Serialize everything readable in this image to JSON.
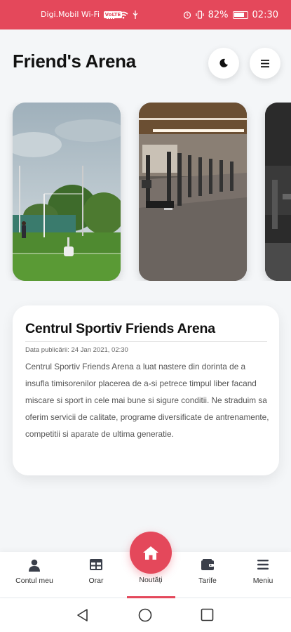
{
  "status_bar": {
    "carrier": "Digi.Mobil Wi-Fi",
    "carrier_badge": "VoLTE",
    "battery": "82%",
    "time": "02:30"
  },
  "header": {
    "title": "Friend's Arena",
    "theme_icon": "moon-icon",
    "menu_icon": "hamburger-icon"
  },
  "carousel": {
    "slides": [
      "football-field-photo",
      "gym-treadmills-photo",
      "gym-equipment-photo"
    ]
  },
  "news": {
    "title": "Centrul Sportiv Friends Arena",
    "date": "Data publicării: 24 Jan 2021, 02:30",
    "body": "Centrul Sportiv Friends Arena a luat nastere din dorinta de a insufla timisorenilor placerea de a-si petrece timpul liber facand miscare si sport in cele mai bune si sigure conditii. Ne straduim sa oferim servicii de calitate, programe diversificate de antrenamente, competitii si aparate de ultima generatie."
  },
  "bottom_nav": {
    "items": [
      {
        "label": "Contul meu",
        "icon": "user-icon"
      },
      {
        "label": "Orar",
        "icon": "table-icon"
      },
      {
        "label": "Noutăți",
        "icon": "home-icon"
      },
      {
        "label": "Tarife",
        "icon": "wallet-icon"
      },
      {
        "label": "Meniu",
        "icon": "menu-icon"
      }
    ]
  },
  "colors": {
    "accent": "#e4485b",
    "background": "#f4f6f8"
  }
}
